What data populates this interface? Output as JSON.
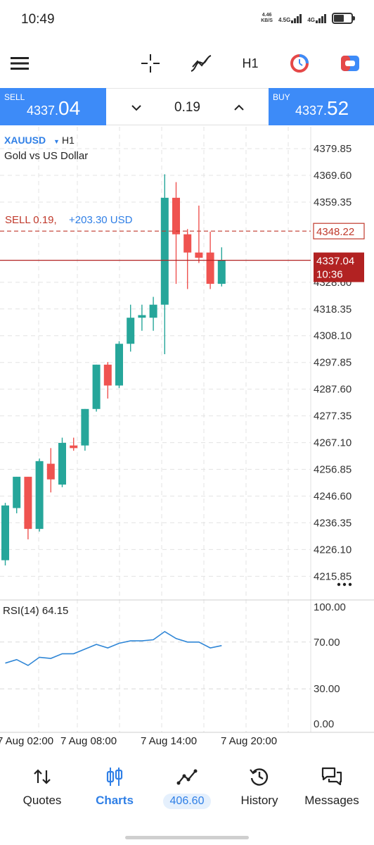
{
  "status": {
    "time": "10:49",
    "net_speed_value": "4.46",
    "net_speed_unit": "KB/S",
    "sig1": "4.5G",
    "sig2": "4G"
  },
  "toolbar": {
    "timeframe": "H1",
    "icons": [
      "menu-icon",
      "crosshair-icon",
      "indicators-icon",
      "timeframe",
      "trade-dial-icon",
      "toggle-icon"
    ]
  },
  "trade": {
    "sell_label": "SELL",
    "sell_price_prefix": "4337.",
    "sell_price_big": "04",
    "volume": "0.19",
    "buy_label": "BUY",
    "buy_price_prefix": "4337.",
    "buy_price_big": "52"
  },
  "chart": {
    "symbol": "XAUUSD",
    "timeframe": "H1",
    "description": "Gold vs US Dollar",
    "position_line": "SELL 0.19,",
    "position_profit": "+203.30 USD",
    "position_price": "4348.22",
    "current_price": "4337.04",
    "current_time": "10:36",
    "rsi_label": "RSI(14) 64.15",
    "x_labels": [
      "7 Aug 02:00",
      "7 Aug 08:00",
      "7 Aug 14:00",
      "7 Aug 20:00"
    ]
  },
  "chart_data": {
    "type": "candlestick",
    "price_axis": [
      "4379.85",
      "4369.60",
      "4359.35",
      "4348.22",
      "4337.04",
      "4328.60",
      "4318.35",
      "4308.10",
      "4297.85",
      "4287.60",
      "4277.35",
      "4267.10",
      "4256.85",
      "4246.60",
      "4236.35",
      "4226.10",
      "4215.85"
    ],
    "ylim": [
      4210,
      4385
    ],
    "colors": {
      "up": "#26a69a",
      "down": "#ef5350",
      "position": "#c0392b",
      "current": "#b22222",
      "rsi": "#2f86d6"
    },
    "candles": [
      {
        "o": 4222,
        "h": 4244,
        "l": 4220,
        "c": 4243
      },
      {
        "o": 4242,
        "h": 4254,
        "l": 4240,
        "c": 4254
      },
      {
        "o": 4254,
        "h": 4254,
        "l": 4230,
        "c": 4234
      },
      {
        "o": 4234,
        "h": 4261,
        "l": 4233,
        "c": 4260
      },
      {
        "o": 4259,
        "h": 4265,
        "l": 4248,
        "c": 4253
      },
      {
        "o": 4251,
        "h": 4269,
        "l": 4250,
        "c": 4267
      },
      {
        "o": 4266,
        "h": 4269,
        "l": 4264,
        "c": 4265
      },
      {
        "o": 4266,
        "h": 4280,
        "l": 4264,
        "c": 4280
      },
      {
        "o": 4280,
        "h": 4297,
        "l": 4279,
        "c": 4297
      },
      {
        "o": 4297,
        "h": 4298,
        "l": 4284,
        "c": 4289
      },
      {
        "o": 4289,
        "h": 4306,
        "l": 4288,
        "c": 4305
      },
      {
        "o": 4305,
        "h": 4320,
        "l": 4302,
        "c": 4315
      },
      {
        "o": 4315,
        "h": 4320,
        "l": 4310,
        "c": 4316
      },
      {
        "o": 4315,
        "h": 4323,
        "l": 4310,
        "c": 4320
      },
      {
        "o": 4320,
        "h": 4370,
        "l": 4301,
        "c": 4361
      },
      {
        "o": 4361,
        "h": 4367,
        "l": 4328,
        "c": 4347
      },
      {
        "o": 4347,
        "h": 4349,
        "l": 4326,
        "c": 4340
      },
      {
        "o": 4340,
        "h": 4358,
        "l": 4336,
        "c": 4338
      },
      {
        "o": 4340,
        "h": 4348,
        "l": 4326,
        "c": 4328
      },
      {
        "o": 4328,
        "h": 4342,
        "l": 4327,
        "c": 4337
      }
    ],
    "rsi_axis": [
      "100.00",
      "70.00",
      "30.00",
      "0.00"
    ],
    "rsi_levels": [
      70,
      30
    ],
    "rsi_values": [
      52,
      55,
      50,
      57,
      56,
      60,
      60,
      64,
      68,
      65,
      69,
      71,
      71,
      72,
      79,
      73,
      70,
      70,
      65,
      67
    ]
  },
  "nav": {
    "quotes": "Quotes",
    "charts": "Charts",
    "trade_badge": "406.60",
    "history": "History",
    "messages": "Messages"
  }
}
